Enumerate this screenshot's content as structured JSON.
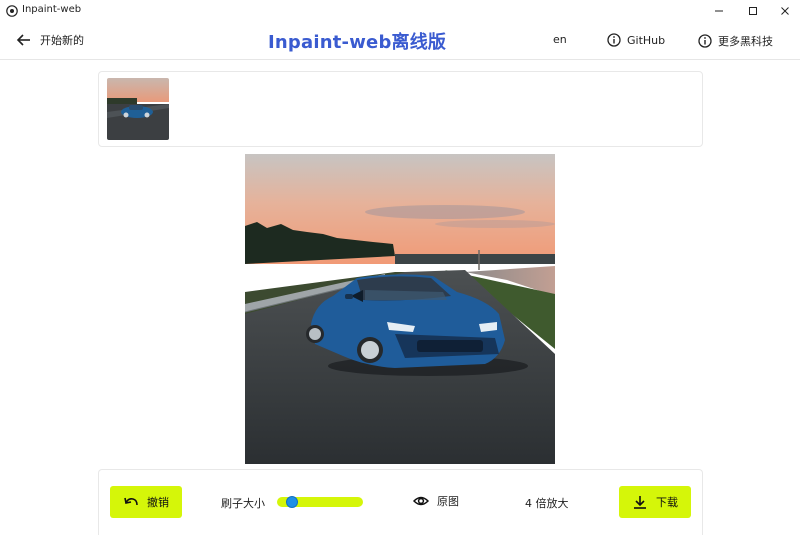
{
  "window": {
    "app_title": "Inpaint-web",
    "minimize_icon": "minimize-icon",
    "maximize_icon": "maximize-icon",
    "close_icon": "close-icon"
  },
  "header": {
    "back_label": "开始新的",
    "title": "Inpaint-web离线版",
    "lang": "en",
    "github_label": "GitHub",
    "more_label": "更多黑科技"
  },
  "toolbar": {
    "undo_label": "撤销",
    "brush_label": "刷子大小",
    "brush_size": 0.12,
    "original_label": "原图",
    "upscale_label": "4 倍放大",
    "download_label": "下载"
  },
  "colors": {
    "accent": "#d5f609",
    "title": "#3a5bd0",
    "slider_knob": "#1e8fe6"
  }
}
